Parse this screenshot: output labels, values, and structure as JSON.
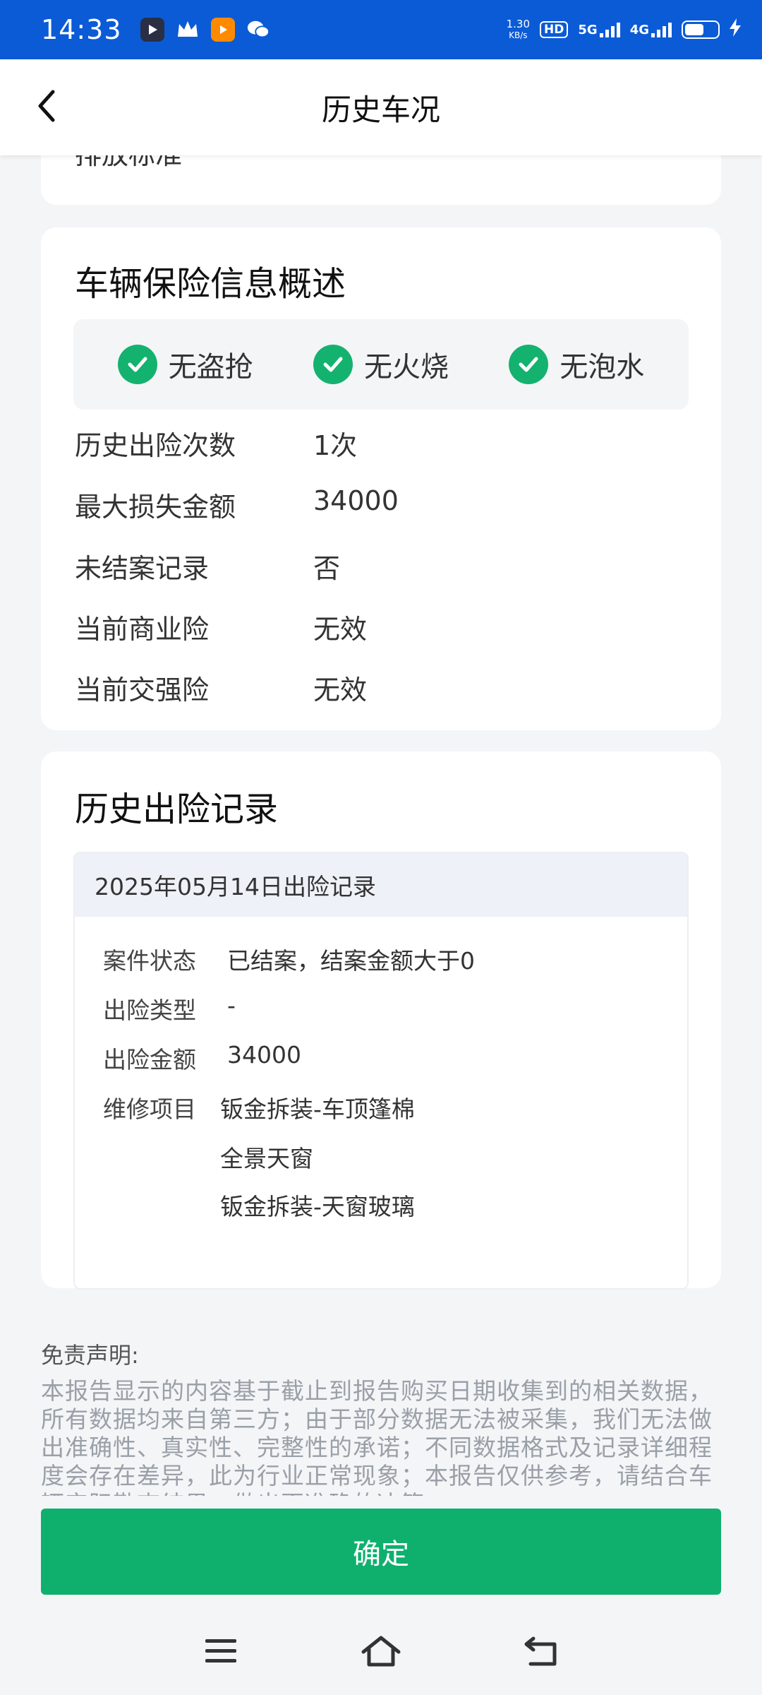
{
  "status_bar": {
    "time": "14:33",
    "speed_value": "1.30",
    "speed_unit": "KB/s",
    "hd_label": "HD",
    "net_5g": "5G",
    "net_4g": "4G"
  },
  "header": {
    "title": "历史车况"
  },
  "top_card": {
    "label": "排放标准",
    "value": "-"
  },
  "insurance": {
    "title": "车辆保险信息概述",
    "badges": [
      "无盗抢",
      "无火烧",
      "无泡水"
    ],
    "rows": [
      {
        "label": "历史出险次数",
        "value": "1次"
      },
      {
        "label": "最大损失金额",
        "value": "34000"
      },
      {
        "label": "未结案记录",
        "value": "否"
      },
      {
        "label": "当前商业险",
        "value": "无效"
      },
      {
        "label": "当前交强险",
        "value": "无效"
      }
    ]
  },
  "history": {
    "title": "历史出险记录",
    "record": {
      "date_title": "2025年05月14日出险记录",
      "status_label": "案件状态",
      "status_value": "已结案，结案金额大于0",
      "type_label": "出险类型",
      "type_value": "-",
      "amount_label": "出险金额",
      "amount_value": "34000",
      "repair_label": "维修项目",
      "repair_items": [
        "钣金拆装-车顶篷棉",
        "全景天窗",
        "钣金拆装-天窗玻璃"
      ]
    }
  },
  "disclaimer": {
    "title": "免责声明:",
    "text": "本报告显示的内容基于截止到报告购买日期收集到的相关数据，所有数据均来自第三方；由于部分数据无法被采集，我们无法做出准确性、真实性、完整性的承诺；不同数据格式及记录详细程度会存在差异，此为行业正常现象；本报告仅供参考，请结合车辆实际勘查结果，做出更准确的决策。"
  },
  "confirm_label": "确定",
  "colors": {
    "status_bar": "#0b5bd6",
    "accent_green": "#0fb06e",
    "check_green": "#14b26f"
  }
}
